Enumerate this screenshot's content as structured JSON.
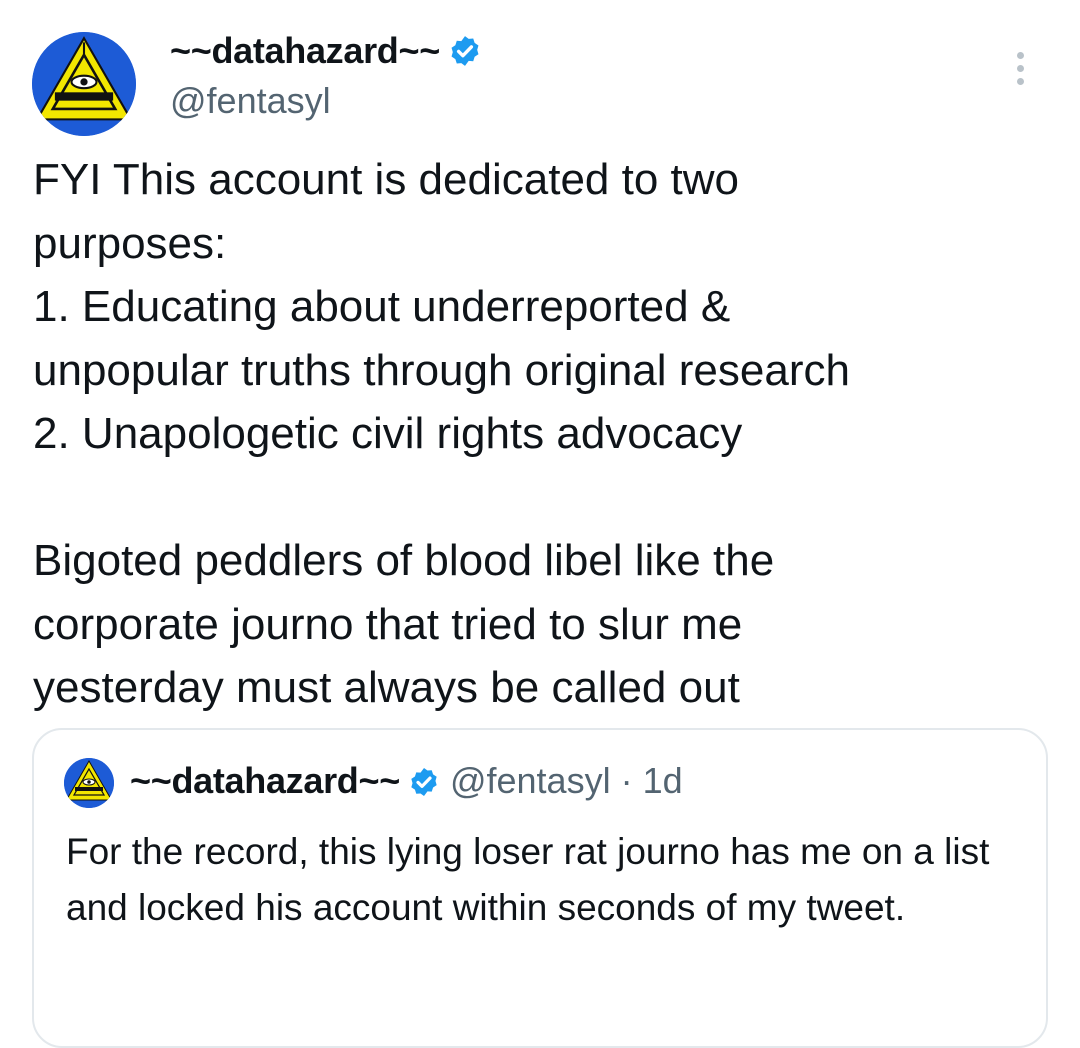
{
  "tweet": {
    "display_name": "~~datahazard~~",
    "handle": "@fentasyl",
    "avatar_icon": "eye-triangle-icon",
    "verified_icon": "verified-badge-icon",
    "more_icon": "more-options-icon",
    "text": "FYI This account is dedicated to two\npurposes:\n1. Educating about underreported &\nunpopular truths through original research\n2. Unapologetic civil rights advocacy\n\nBigoted peddlers of blood libel like the\ncorporate journo that tried to slur me\nyesterday must always be called out"
  },
  "quoted_tweet": {
    "display_name": "~~datahazard~~",
    "handle": "@fentasyl",
    "separator": " · ",
    "age": "1d",
    "text": "For the record, this lying loser rat journo has me on a list and locked his account within seconds of my tweet."
  },
  "colors": {
    "verified": "#1d9bf0",
    "secondary_text": "#536471",
    "avatar_blue": "#1d5bd6",
    "avatar_yellow": "#f2e600"
  }
}
